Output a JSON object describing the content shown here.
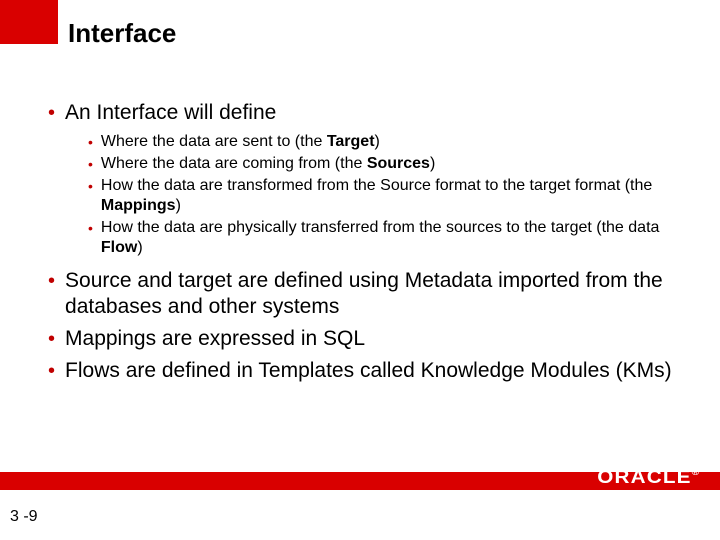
{
  "title": "Interface",
  "pageNumber": "3 -9",
  "brand": "ORACLE",
  "bullets": [
    {
      "text": "An Interface will define",
      "sub": [
        {
          "pre": "Where the data are sent to (the ",
          "bold": "Target",
          "post": ")"
        },
        {
          "pre": "Where the data are coming from (the ",
          "bold": "Sources",
          "post": ")"
        },
        {
          "pre": "How the data are transformed from the Source format to the target format (the ",
          "bold": "Mappings",
          "post": ")"
        },
        {
          "pre": "How the data are physically transferred from the sources to the target (the data ",
          "bold": "Flow",
          "post": ")"
        }
      ]
    },
    {
      "text": "Source and target are defined using Metadata imported from the databases and other systems"
    },
    {
      "text": "Mappings are expressed in SQL"
    },
    {
      "text": "Flows are defined in Templates called Knowledge Modules (KMs)"
    }
  ]
}
